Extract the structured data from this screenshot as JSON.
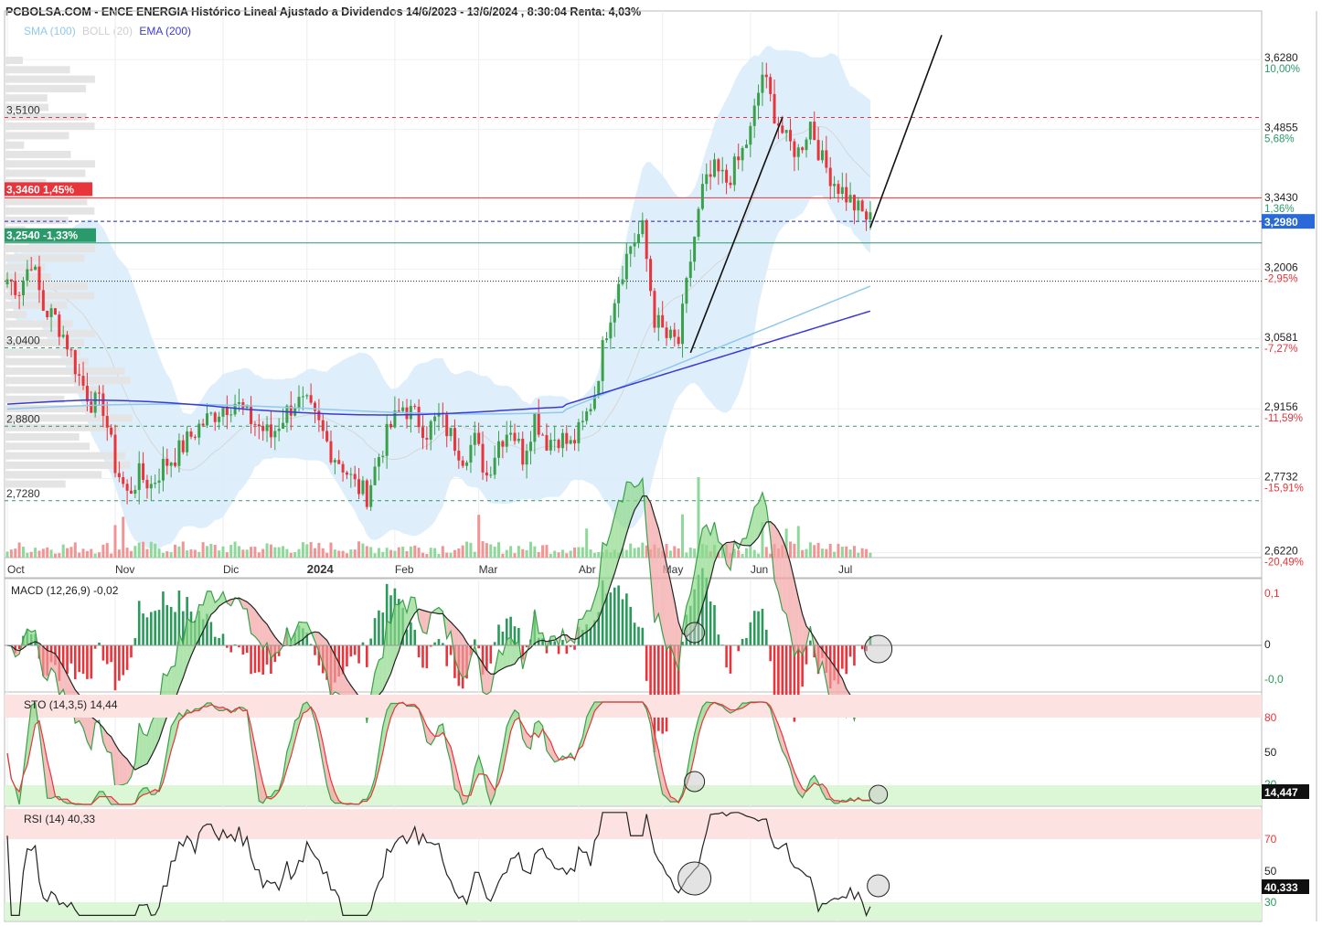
{
  "title": "PCBOLSA.COM - ENCE ENERGIA Histórico Lineal Ajustado a Dividendos 14/6/2023 - 13/6/2024 , 8:30:04 Renta: 4,03%",
  "legend": {
    "sma": "SMA (100)",
    "boll": "BOLL (20)",
    "ema": "EMA (200)",
    "colors": {
      "sma": "#90c8ee",
      "boll": "#d0d0d0",
      "ema": "#3a3ad8"
    }
  },
  "colors": {
    "up": "#3aa04a",
    "down": "#e8343a",
    "resistance": "#e8343a",
    "support": "#2a9a6a",
    "current": "#2020c0"
  },
  "chart_data": {
    "type": "candlestick",
    "x_ticks": [
      "Oct",
      "Nov",
      "Dic",
      "2024",
      "Feb",
      "Mar",
      "Abr",
      "May",
      "Jun",
      "Jul"
    ],
    "y_axis": [
      {
        "value": "3,6280",
        "pct": "10,00%",
        "pct_sign": "pos"
      },
      {
        "value": "3,4855",
        "pct": "5,68%",
        "pct_sign": "pos"
      },
      {
        "value": "3,3430",
        "pct": "1,36%",
        "pct_sign": "pos"
      },
      {
        "value": "3,2006",
        "pct": "-2,95%",
        "pct_sign": "neg"
      },
      {
        "value": "3,0581",
        "pct": "-7,27%",
        "pct_sign": "neg"
      },
      {
        "value": "2,9156",
        "pct": "-11,59%",
        "pct_sign": "neg"
      },
      {
        "value": "2,7732",
        "pct": "-15,91%",
        "pct_sign": "neg"
      },
      {
        "value": "2,6220",
        "pct": "-20,49%",
        "pct_sign": "neg"
      }
    ],
    "y_range": [
      2.612,
      3.675
    ],
    "levels": [
      {
        "label": "3,5100",
        "value": 3.51,
        "style": "dashed-red"
      },
      {
        "label": "3,3460  1,45%",
        "value": 3.346,
        "style": "solid-red"
      },
      {
        "label": "3,2980",
        "value": 3.298,
        "style": "dashed-blue"
      },
      {
        "label": "3,2540  -1,33%",
        "value": 3.254,
        "style": "solid-green"
      },
      {
        "label": "",
        "value": 3.176,
        "style": "dotted-black"
      },
      {
        "label": "3,0400",
        "value": 3.04,
        "style": "dashed-green"
      },
      {
        "label": "2,8800",
        "value": 2.88,
        "style": "dashed-green"
      },
      {
        "label": "2,7280",
        "value": 2.728,
        "style": "dashed-green"
      }
    ],
    "current_price": "3,2980",
    "close_path": [
      [
        0,
        3.18
      ],
      [
        3,
        3.16
      ],
      [
        6,
        3.22
      ],
      [
        9,
        3.12
      ],
      [
        12,
        3.1
      ],
      [
        15,
        3.05
      ],
      [
        18,
        2.98
      ],
      [
        21,
        2.93
      ],
      [
        24,
        2.92
      ],
      [
        27,
        2.8
      ],
      [
        30,
        2.74
      ],
      [
        33,
        2.78
      ],
      [
        36,
        2.76
      ],
      [
        39,
        2.8
      ],
      [
        42,
        2.82
      ],
      [
        45,
        2.85
      ],
      [
        48,
        2.88
      ],
      [
        51,
        2.9
      ],
      [
        54,
        2.92
      ],
      [
        57,
        2.93
      ],
      [
        60,
        2.9
      ],
      [
        63,
        2.88
      ],
      [
        66,
        2.86
      ],
      [
        69,
        2.9
      ],
      [
        72,
        2.93
      ],
      [
        75,
        2.92
      ],
      [
        78,
        2.88
      ],
      [
        81,
        2.83
      ],
      [
        84,
        2.8
      ],
      [
        87,
        2.76
      ],
      [
        90,
        2.74
      ],
      [
        93,
        2.82
      ],
      [
        96,
        2.88
      ],
      [
        99,
        2.92
      ],
      [
        102,
        2.9
      ],
      [
        105,
        2.87
      ],
      [
        108,
        2.9
      ],
      [
        111,
        2.86
      ],
      [
        114,
        2.82
      ],
      [
        117,
        2.85
      ],
      [
        120,
        2.78
      ],
      [
        123,
        2.85
      ],
      [
        126,
        2.88
      ],
      [
        129,
        2.82
      ],
      [
        132,
        2.9
      ],
      [
        135,
        2.85
      ],
      [
        138,
        2.86
      ],
      [
        141,
        2.84
      ],
      [
        144,
        2.88
      ],
      [
        147,
        2.95
      ],
      [
        150,
        3.08
      ],
      [
        153,
        3.18
      ],
      [
        156,
        3.25
      ],
      [
        159,
        3.28
      ],
      [
        162,
        3.1
      ],
      [
        165,
        3.06
      ],
      [
        168,
        3.05
      ],
      [
        171,
        3.22
      ],
      [
        174,
        3.36
      ],
      [
        177,
        3.4
      ],
      [
        180,
        3.38
      ],
      [
        183,
        3.42
      ],
      [
        186,
        3.48
      ],
      [
        189,
        3.6
      ],
      [
        192,
        3.52
      ],
      [
        195,
        3.46
      ],
      [
        198,
        3.44
      ],
      [
        201,
        3.5
      ],
      [
        204,
        3.42
      ],
      [
        207,
        3.38
      ],
      [
        210,
        3.35
      ],
      [
        213,
        3.32
      ],
      [
        216,
        3.3
      ]
    ],
    "indicators": [
      {
        "name": "MACD (12,26,9)",
        "value": "-0,02",
        "y_labels": [
          "0,1",
          "0",
          "-0,0"
        ]
      },
      {
        "name": "STO (14,3,5)",
        "value": "14,44",
        "y_labels": [
          "80",
          "50",
          "20"
        ],
        "badge": "14,447"
      },
      {
        "name": "RSI (14)",
        "value": "40,33",
        "y_labels": [
          "70",
          "50",
          "30"
        ],
        "badge": "40,333"
      }
    ]
  }
}
